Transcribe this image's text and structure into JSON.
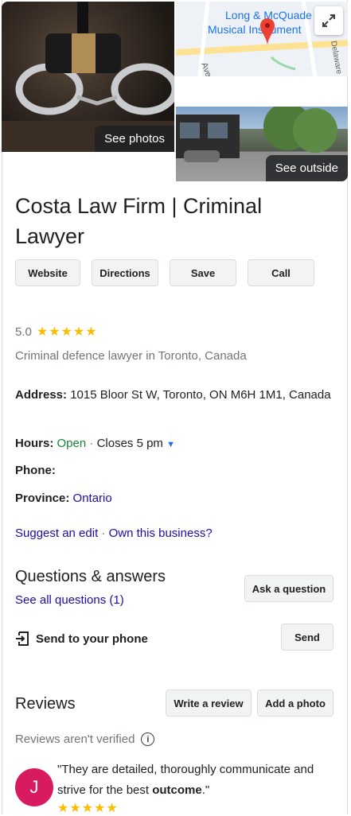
{
  "photos": {
    "main_label": "See photos",
    "outside_label": "See outside",
    "map_text_line1": "Long & McQuade",
    "map_text_line2": "Musical Instrument",
    "map_street1": "Ave",
    "map_street2": "Delaware"
  },
  "business": {
    "title": "Costa Law Firm | Criminal Lawyer",
    "rating": "5.0",
    "stars": "★★★★★",
    "category": "Criminal defence lawyer in Toronto, Canada"
  },
  "actions": {
    "website": "Website",
    "directions": "Directions",
    "save": "Save",
    "call": "Call"
  },
  "details": {
    "address_label": "Address:",
    "address_value": "1015 Bloor St W, Toronto, ON M6H 1M1, Canada",
    "hours_label": "Hours:",
    "hours_status": "Open",
    "hours_sep": "·",
    "hours_close": "Closes 5 pm",
    "phone_label": "Phone:",
    "province_label": "Province:",
    "province_value": "Ontario"
  },
  "links": {
    "suggest_edit": "Suggest an edit",
    "sep": "·",
    "own_business": "Own this business?"
  },
  "qa": {
    "title": "Questions & answers",
    "see_all": "See all questions (1)",
    "ask_button": "Ask a question"
  },
  "send": {
    "label": "Send to your phone",
    "button": "Send"
  },
  "reviews": {
    "title": "Reviews",
    "write_button": "Write a review",
    "add_photo_button": "Add a photo",
    "not_verified": "Reviews aren't verified",
    "avatar_letter": "J",
    "review_text_start": "\"They are detailed, thoroughly communicate and strive for the best ",
    "review_text_bold": "outcome",
    "review_text_end": ".\"",
    "review_stars": "★★★★★"
  }
}
